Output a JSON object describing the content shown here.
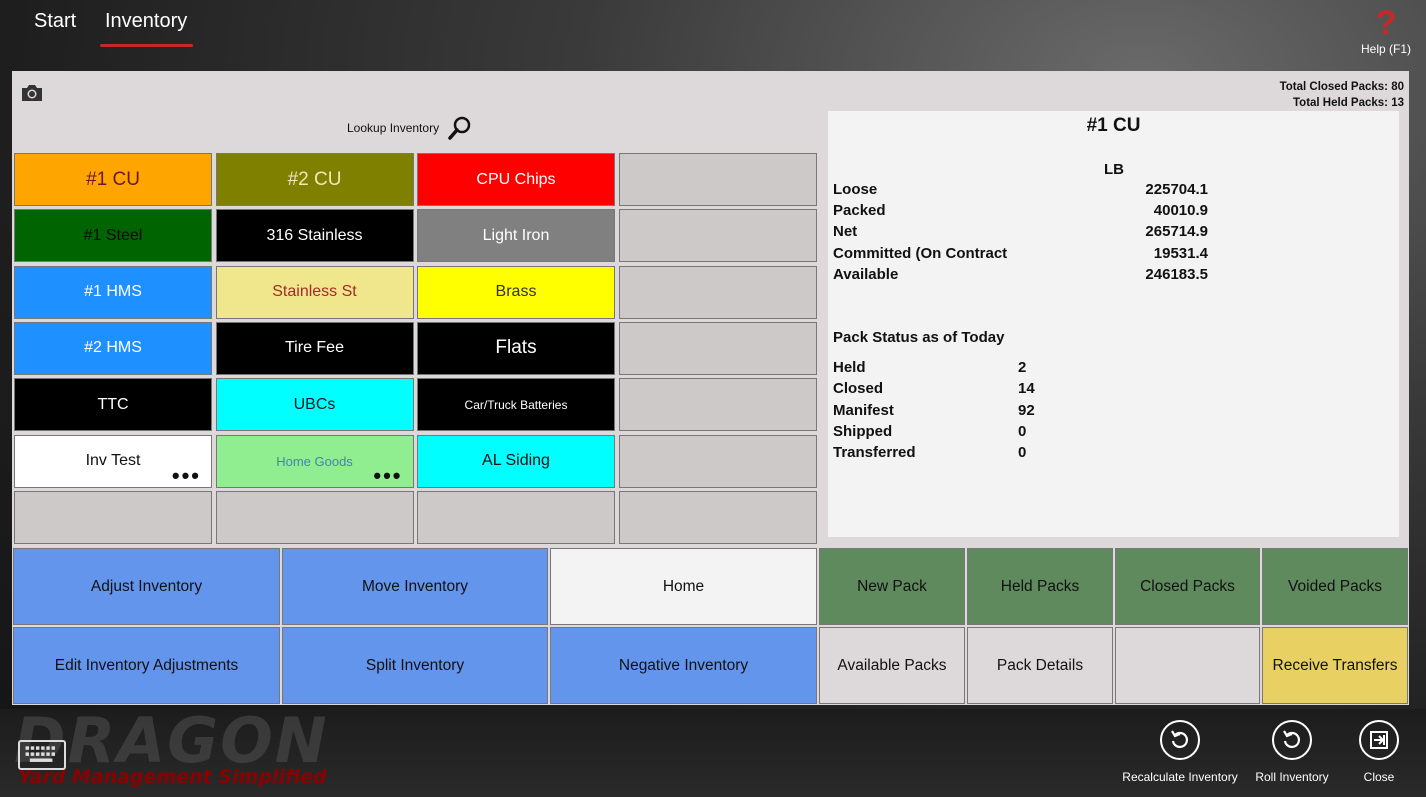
{
  "nav": {
    "start": "Start",
    "inventory": "Inventory",
    "help": "Help (F1)",
    "help_mark": "?"
  },
  "totals": {
    "closed": "Total Closed Packs: 80",
    "held": "Total Held Packs: 13"
  },
  "lookup": {
    "label": "Lookup Inventory"
  },
  "tiles": [
    {
      "label": "#1 CU",
      "bg": "#ffa500",
      "fg": "#6a1b1b"
    },
    {
      "label": "#2 CU",
      "bg": "#808000",
      "fg": "#f5e6b8"
    },
    {
      "label": "CPU Chips",
      "bg": "#ff0000",
      "fg": "#ffffff"
    },
    {
      "label": "",
      "bg": "#cdc9c9",
      "fg": "#111"
    },
    {
      "label": "#1 Steel",
      "bg": "#006400",
      "fg": "#0a0a0a"
    },
    {
      "label": "316 Stainless",
      "bg": "#000000",
      "fg": "#ffffff"
    },
    {
      "label": "Light Iron",
      "bg": "#808080",
      "fg": "#ffffff"
    },
    {
      "label": "",
      "bg": "#cdc9c9",
      "fg": "#111"
    },
    {
      "label": "#1 HMS",
      "bg": "#1e90ff",
      "fg": "#ffffff"
    },
    {
      "label": "Stainless St",
      "bg": "#f0e68c",
      "fg": "#a52a2a"
    },
    {
      "label": "Brass",
      "bg": "#ffff00",
      "fg": "#333333"
    },
    {
      "label": "",
      "bg": "#cdc9c9",
      "fg": "#111"
    },
    {
      "label": "#2 HMS",
      "bg": "#1e90ff",
      "fg": "#ffffff"
    },
    {
      "label": "Tire Fee",
      "bg": "#000000",
      "fg": "#ffffff"
    },
    {
      "label": "Flats",
      "bg": "#000000",
      "fg": "#ffffff"
    },
    {
      "label": "",
      "bg": "#cdc9c9",
      "fg": "#111"
    },
    {
      "label": "TTC",
      "bg": "#000000",
      "fg": "#ffffff"
    },
    {
      "label": "UBCs",
      "bg": "#00ffff",
      "fg": "#1a1a1a"
    },
    {
      "label": "Car/Truck Batteries",
      "bg": "#000000",
      "fg": "#ffffff"
    },
    {
      "label": "",
      "bg": "#cdc9c9",
      "fg": "#111"
    },
    {
      "label": "Inv Test",
      "bg": "#ffffff",
      "fg": "#111111",
      "dots": "•••"
    },
    {
      "label": "Home Goods",
      "bg": "#90ee90",
      "fg": "#4682b4",
      "dots": "•••"
    },
    {
      "label": "AL Siding",
      "bg": "#00ffff",
      "fg": "#111111"
    },
    {
      "label": "",
      "bg": "#cdc9c9",
      "fg": "#111"
    },
    {
      "label": "",
      "bg": "#cdc9c9",
      "fg": "#111"
    },
    {
      "label": "",
      "bg": "#cdc9c9",
      "fg": "#111"
    },
    {
      "label": "",
      "bg": "#cdc9c9",
      "fg": "#111"
    },
    {
      "label": "",
      "bg": "#cdc9c9",
      "fg": "#111"
    }
  ],
  "info": {
    "title": "#1 CU",
    "unit": "LB",
    "rows": [
      {
        "label": "Loose",
        "value": "225704.1"
      },
      {
        "label": "Packed",
        "value": "40010.9"
      },
      {
        "label": "Net",
        "value": "265714.9"
      },
      {
        "label": "Committed (On Contract",
        "value": "19531.4"
      },
      {
        "label": "Available",
        "value": "246183.5"
      }
    ],
    "status_title": "Pack Status as of Today",
    "status": [
      {
        "label": "Held",
        "value": "2"
      },
      {
        "label": "Closed",
        "value": "14"
      },
      {
        "label": "Manifest",
        "value": "92"
      },
      {
        "label": "Shipped",
        "value": "0"
      },
      {
        "label": "Transferred",
        "value": "0"
      }
    ]
  },
  "actions": {
    "adjust": "Adjust Inventory",
    "move": "Move Inventory",
    "home": "Home",
    "new_pack": "New Pack",
    "held_packs": "Held Packs",
    "closed_packs": "Closed Packs",
    "voided_packs": "Voided Packs",
    "edit_adj": "Edit Inventory Adjustments",
    "split": "Split Inventory",
    "negative": "Negative Inventory",
    "available_packs": "Available Packs",
    "pack_details": "Pack Details",
    "receive": "Receive Transfers"
  },
  "brand": {
    "name": "DRAGON",
    "tagline": "Yard Management Simplified"
  },
  "bottom": {
    "recalc": "Recalculate Inventory",
    "roll": "Roll Inventory",
    "close": "Close"
  }
}
